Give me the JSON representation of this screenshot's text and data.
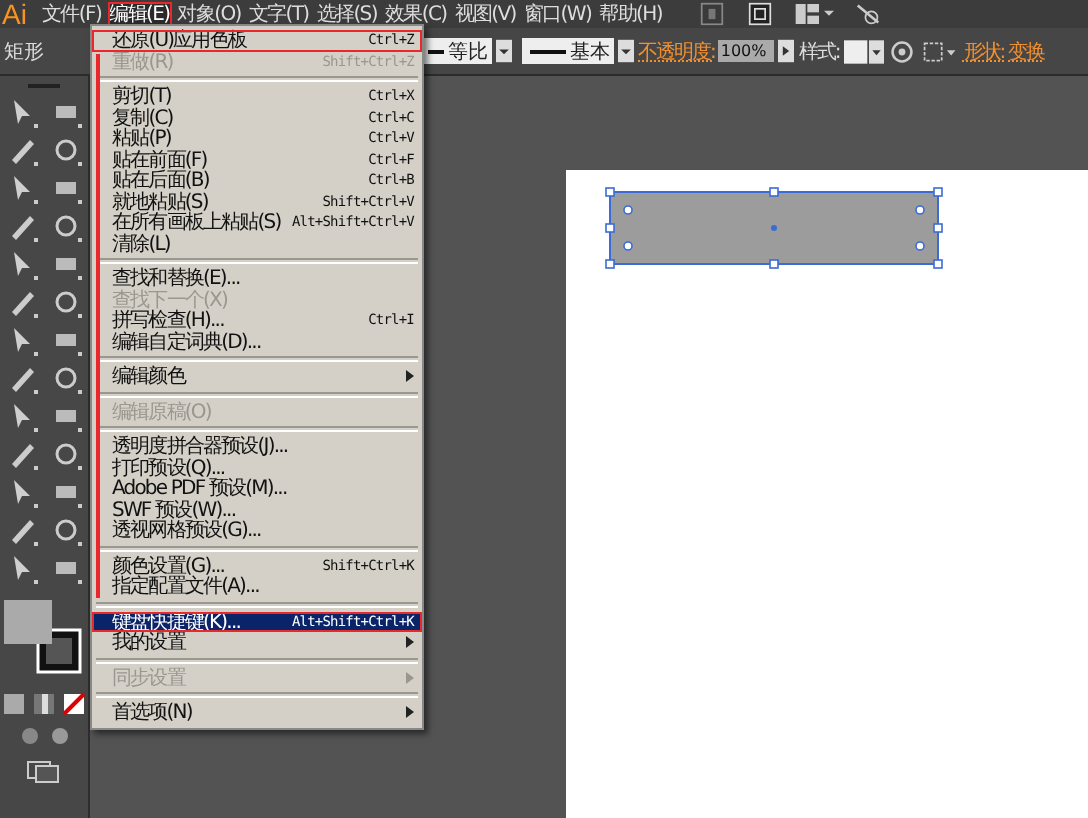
{
  "app_logo": "Ai",
  "menubar": [
    {
      "label": "文件(F)",
      "selected": false
    },
    {
      "label": "编辑(E)",
      "selected": true
    },
    {
      "label": "对象(O)",
      "selected": false
    },
    {
      "label": "文字(T)",
      "selected": false
    },
    {
      "label": "选择(S)",
      "selected": false
    },
    {
      "label": "效果(C)",
      "selected": false
    },
    {
      "label": "视图(V)",
      "selected": false
    },
    {
      "label": "窗口(W)",
      "selected": false
    },
    {
      "label": "帮助(H)",
      "selected": false
    }
  ],
  "control_bar": {
    "tool_name": "矩形",
    "stroke_profile": "等比",
    "brush": "基本",
    "opacity_label": "不透明度:",
    "opacity": "100%",
    "style_label": "样式:",
    "shape_label": "形状:",
    "transform_label": "变换"
  },
  "edit_menu": [
    {
      "kind": "item",
      "label": "还原(U)应用色板",
      "shortcut": "Ctrl+Z",
      "disabled": false,
      "selected": false,
      "submenu": false
    },
    {
      "kind": "item",
      "label": "重做(R)",
      "shortcut": "Shift+Ctrl+Z",
      "disabled": true,
      "selected": false,
      "submenu": false
    },
    {
      "kind": "separator"
    },
    {
      "kind": "item",
      "label": "剪切(T)",
      "shortcut": "Ctrl+X",
      "disabled": false,
      "selected": false,
      "submenu": false
    },
    {
      "kind": "item",
      "label": "复制(C)",
      "shortcut": "Ctrl+C",
      "disabled": false,
      "selected": false,
      "submenu": false
    },
    {
      "kind": "item",
      "label": "粘贴(P)",
      "shortcut": "Ctrl+V",
      "disabled": false,
      "selected": false,
      "submenu": false
    },
    {
      "kind": "item",
      "label": "贴在前面(F)",
      "shortcut": "Ctrl+F",
      "disabled": false,
      "selected": false,
      "submenu": false
    },
    {
      "kind": "item",
      "label": "贴在后面(B)",
      "shortcut": "Ctrl+B",
      "disabled": false,
      "selected": false,
      "submenu": false
    },
    {
      "kind": "item",
      "label": "就地粘贴(S)",
      "shortcut": "Shift+Ctrl+V",
      "disabled": false,
      "selected": false,
      "submenu": false
    },
    {
      "kind": "item",
      "label": "在所有画板上粘贴(S)",
      "shortcut": "Alt+Shift+Ctrl+V",
      "disabled": false,
      "selected": false,
      "submenu": false
    },
    {
      "kind": "item",
      "label": "清除(L)",
      "disabled": false,
      "selected": false,
      "submenu": false
    },
    {
      "kind": "separator"
    },
    {
      "kind": "item",
      "label": "查找和替换(E)...",
      "disabled": false,
      "selected": false,
      "submenu": false
    },
    {
      "kind": "item",
      "label": "查找下一个(X)",
      "disabled": true,
      "selected": false,
      "submenu": false
    },
    {
      "kind": "item",
      "label": "拼写检查(H)...",
      "shortcut": "Ctrl+I",
      "disabled": false,
      "selected": false,
      "submenu": false
    },
    {
      "kind": "item",
      "label": "编辑自定词典(D)...",
      "disabled": false,
      "selected": false,
      "submenu": false
    },
    {
      "kind": "separator"
    },
    {
      "kind": "item",
      "label": "编辑颜色",
      "disabled": false,
      "selected": false,
      "submenu": true
    },
    {
      "kind": "separator"
    },
    {
      "kind": "item",
      "label": "编辑原稿(O)",
      "disabled": true,
      "selected": false,
      "submenu": false
    },
    {
      "kind": "separator"
    },
    {
      "kind": "item",
      "label": "透明度拼合器预设(J)...",
      "disabled": false,
      "selected": false,
      "submenu": false
    },
    {
      "kind": "item",
      "label": "打印预设(Q)...",
      "disabled": false,
      "selected": false,
      "submenu": false
    },
    {
      "kind": "item",
      "label": "Adobe PDF 预设(M)...",
      "disabled": false,
      "selected": false,
      "submenu": false
    },
    {
      "kind": "item",
      "label": "SWF 预设(W)...",
      "disabled": false,
      "selected": false,
      "submenu": false
    },
    {
      "kind": "item",
      "label": "透视网格预设(G)...",
      "disabled": false,
      "selected": false,
      "submenu": false
    },
    {
      "kind": "separator"
    },
    {
      "kind": "item",
      "label": "颜色设置(G)...",
      "shortcut": "Shift+Ctrl+K",
      "disabled": false,
      "selected": false,
      "submenu": false
    },
    {
      "kind": "item",
      "label": "指定配置文件(A)...",
      "disabled": false,
      "selected": false,
      "submenu": false
    },
    {
      "kind": "separator"
    },
    {
      "kind": "item",
      "label": "键盘快捷键(K)...",
      "shortcut": "Alt+Shift+Ctrl+K",
      "disabled": false,
      "selected": true,
      "submenu": false
    },
    {
      "kind": "item",
      "label": "我的设置",
      "disabled": false,
      "selected": false,
      "submenu": true
    },
    {
      "kind": "separator"
    },
    {
      "kind": "item",
      "label": "同步设置",
      "disabled": true,
      "selected": false,
      "submenu": true
    },
    {
      "kind": "separator"
    },
    {
      "kind": "item",
      "label": "首选项(N)",
      "disabled": false,
      "selected": false,
      "submenu": true
    }
  ]
}
